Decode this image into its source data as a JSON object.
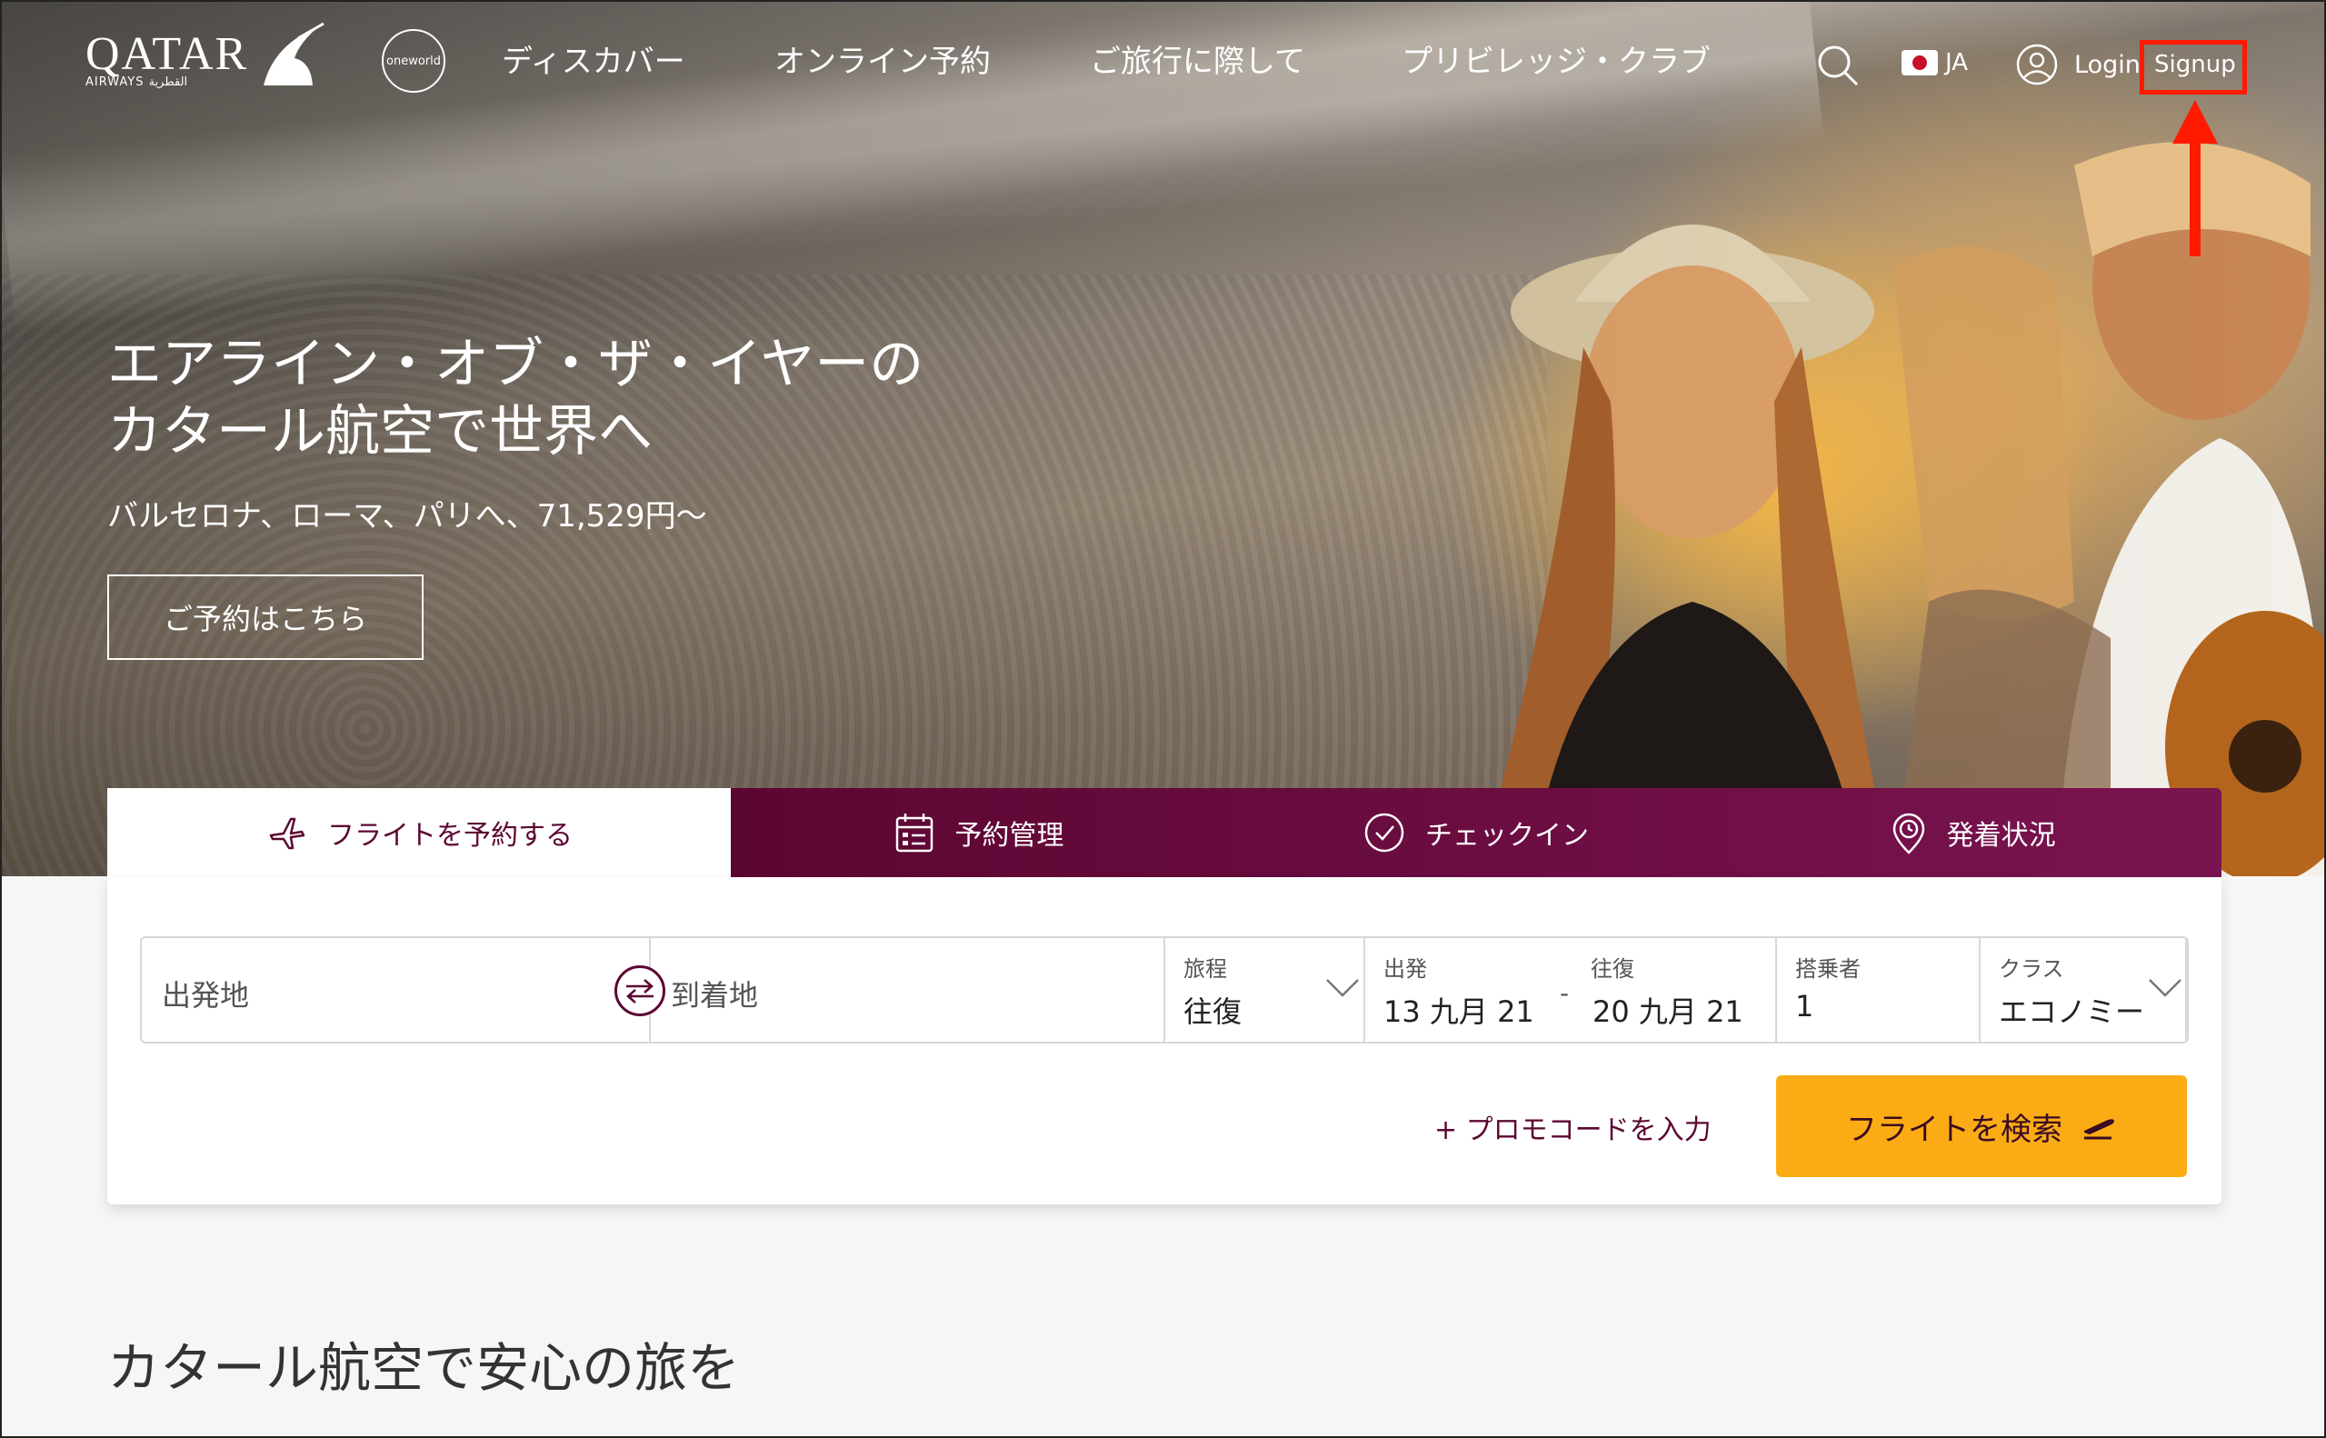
{
  "nav": {
    "logo": {
      "word": "QATAR",
      "sub": "AIRWAYS القطرية"
    },
    "oneworld": "oneworld",
    "items": [
      {
        "label": "ディスカバー"
      },
      {
        "label": "オンライン予約"
      },
      {
        "label": "ご旅行に際して"
      },
      {
        "label": "プリビレッジ・クラブ"
      }
    ],
    "language": "JA",
    "login": "Login",
    "signup": "Signup"
  },
  "hero": {
    "headline_line1": "エアライン・オブ・ザ・イヤーの",
    "headline_line2": "カタール航空で世界へ",
    "subline": "バルセロナ、ローマ、パリへ、71,529円〜",
    "cta": "ご予約はこちら"
  },
  "booking": {
    "tabs": [
      {
        "label": "フライトを予約する",
        "icon": "plane-icon"
      },
      {
        "label": "予約管理",
        "icon": "calendar-icon"
      },
      {
        "label": "チェックイン",
        "icon": "check-circle-icon"
      },
      {
        "label": "発着状況",
        "icon": "clock-pin-icon"
      }
    ],
    "origin_placeholder": "出発地",
    "destination_placeholder": "到着地",
    "trip_type": {
      "label": "旅程",
      "value": "往復"
    },
    "depart": {
      "label": "出発",
      "value": "13 九月 21"
    },
    "separator": "-",
    "return": {
      "label": "往復",
      "value": "20 九月 21"
    },
    "passengers": {
      "label": "搭乗者",
      "value": "1"
    },
    "cabin": {
      "label": "クラス",
      "value": "エコノミー"
    },
    "promo": "+ プロモコードを入力",
    "search_button": "フライトを検索"
  },
  "section_title": "カタール航空で安心の旅を",
  "colors": {
    "brand": "#5c0632",
    "accent": "#fbac15",
    "highlight": "#ff1a00"
  }
}
